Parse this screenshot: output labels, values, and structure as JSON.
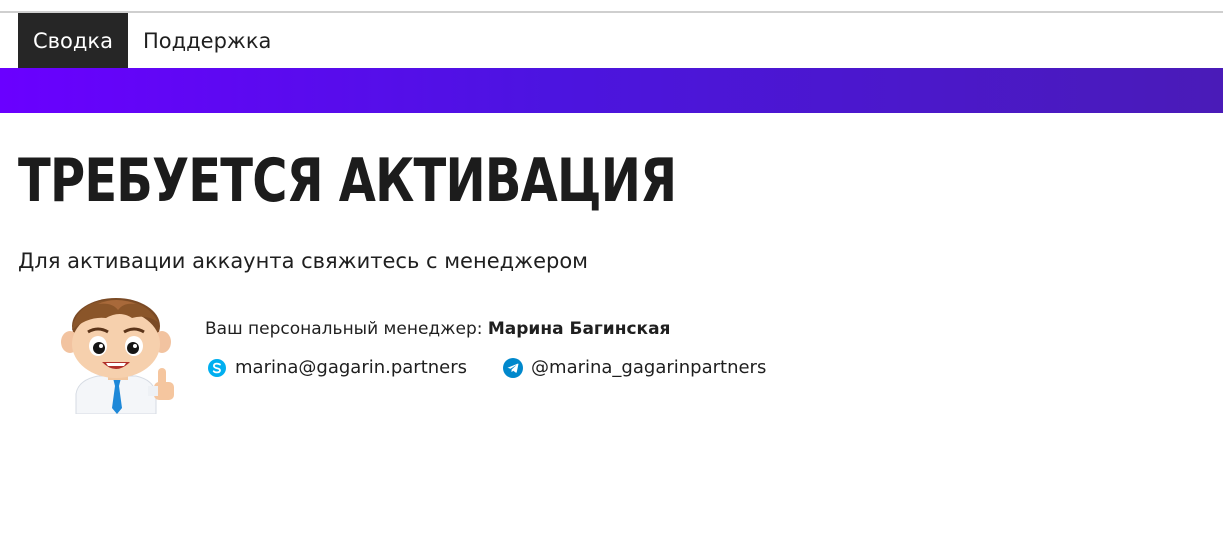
{
  "nav": {
    "tabs": [
      {
        "label": "Сводка",
        "active": true
      },
      {
        "label": "Поддержка",
        "active": false
      }
    ]
  },
  "banner": {
    "color_start": "#6a00ff",
    "color_end": "#4a1bb8"
  },
  "page": {
    "title": "ТРЕБУЕТСЯ АКТИВАЦИЯ",
    "subtitle": "Для активации аккаунта свяжитесь с менеджером"
  },
  "manager": {
    "label": "Ваш персональный менеджер:",
    "name": "Марина Багинская",
    "skype": {
      "icon": "skype-icon",
      "value": "marina@gagarin.partners",
      "color": "#00aff0"
    },
    "telegram": {
      "icon": "telegram-icon",
      "value": "@marina_gagarinpartners",
      "color": "#0088cc"
    }
  }
}
